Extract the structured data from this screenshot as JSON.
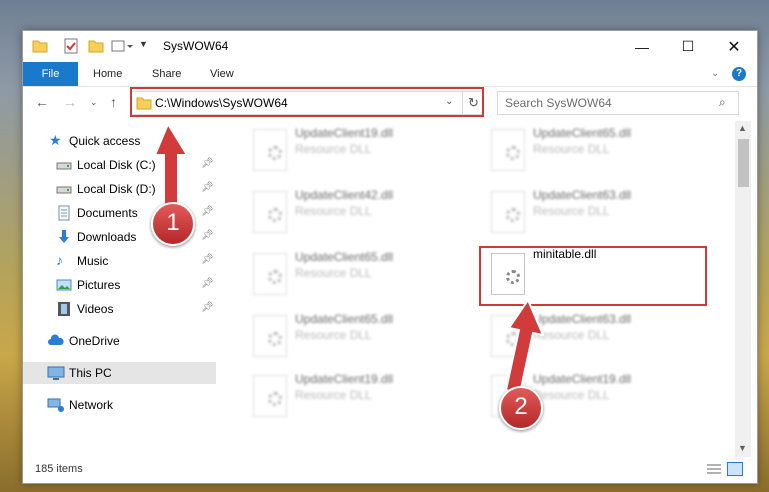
{
  "window": {
    "title": "SysWOW64"
  },
  "ribbon": {
    "tabs": [
      "File",
      "Home",
      "Share",
      "View"
    ]
  },
  "address": {
    "path": "C:\\Windows\\SysWOW64"
  },
  "search": {
    "placeholder": "Search SysWOW64"
  },
  "sidebar": {
    "quick_access": "Quick access",
    "items": [
      "Local Disk (C:)",
      "Local Disk (D:)",
      "Documents",
      "Downloads",
      "Music",
      "Pictures",
      "Videos"
    ],
    "onedrive": "OneDrive",
    "this_pc": "This PC",
    "network": "Network"
  },
  "files": [
    {
      "name": "UpdateClient19.dll",
      "type": "Resource DLL"
    },
    {
      "name": "UpdateClient65.dll",
      "type": "Resource DLL"
    },
    {
      "name": "UpdateClient42.dll",
      "type": "Resource DLL"
    },
    {
      "name": "UpdateClient63.dll",
      "type": "Resource DLL"
    },
    {
      "name": "UpdateClient65.dll",
      "type": "Resource DLL"
    },
    {
      "name": "minitable.dll",
      "type": ""
    },
    {
      "name": "UpdateClient65.dll",
      "type": "Resource DLL"
    },
    {
      "name": "UpdateClient63.dll",
      "type": "Resource DLL"
    },
    {
      "name": "UpdateClient19.dll",
      "type": "Resource DLL"
    },
    {
      "name": "UpdateClient19.dll",
      "type": "Resource DLL"
    }
  ],
  "status": {
    "item_count": "185 items"
  },
  "annotations": {
    "step1": "1",
    "step2": "2",
    "color": "#cd3a3a"
  }
}
